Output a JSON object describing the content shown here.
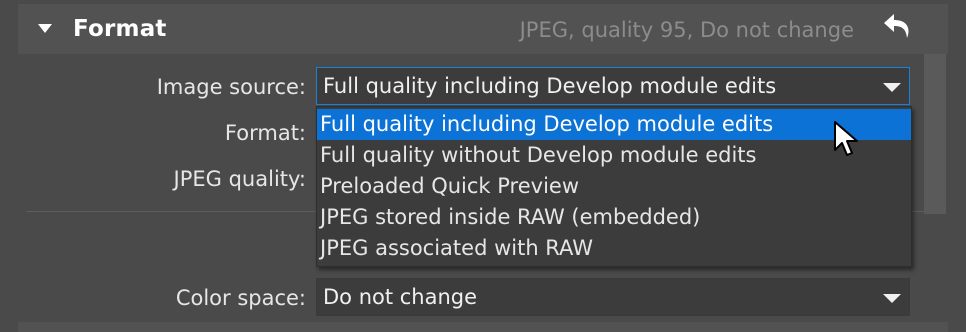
{
  "section": {
    "title": "Format",
    "summary": "JPEG, quality 95, Do not change",
    "collapse_icon": "triangle-down-icon",
    "reset_icon": "undo-arrow-icon"
  },
  "fields": {
    "image_source_label": "Image source:",
    "image_source_value": "Full quality including Develop module edits",
    "format_label": "Format:",
    "jpeg_quality_label": "JPEG quality:",
    "color_space_label": "Color space:",
    "color_space_value": "Do not change"
  },
  "dropdown": {
    "options": [
      "Full quality including Develop module edits",
      "Full quality without Develop module edits",
      "Preloaded Quick Preview",
      "JPEG stored inside RAW (embedded)",
      "JPEG associated with RAW"
    ],
    "selected_index": 0
  },
  "colors": {
    "accent": "#0c72d6",
    "focus_border": "#1d7fd6",
    "panel_bg": "#4a4a4a",
    "header_bg": "#525252",
    "summary_text": "#8c8c8c"
  }
}
